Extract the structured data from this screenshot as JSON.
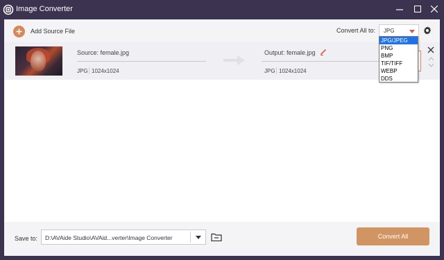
{
  "app": {
    "title": "Image Converter",
    "logo_icon": "avaide-logo-icon"
  },
  "window_controls": {
    "minimize_icon": "minimize-icon",
    "maximize_icon": "maximize-icon",
    "close_icon": "close-icon"
  },
  "toolbar": {
    "add_source_label": "Add Source File",
    "convert_all_label": "Convert All to:",
    "convert_all_value": "JPG",
    "settings_icon": "gear-icon"
  },
  "format_dropdown": {
    "options": [
      "JPG/JPEG",
      "PNG",
      "BMP",
      "TIF/TIFF",
      "WEBP",
      "DDS"
    ],
    "selected": "JPG/JPEG"
  },
  "file": {
    "source_label": "Source: female.jpg",
    "source_format": "JPG",
    "source_dimensions": "1024x1024",
    "output_label": "Output: female.jpg",
    "output_format": "JPG",
    "output_dimensions": "1024x1024"
  },
  "bottom": {
    "save_to_label": "Save to:",
    "save_path": "D:\\AVAide Studio\\AVAid...verter\\Image Converter",
    "convert_all_button": "Convert All"
  },
  "colors": {
    "title_bar": "#3b3350",
    "accent": "#d19563",
    "dropdown_selected": "#1e73e8",
    "toolbar_bg": "#f4f3f6"
  }
}
